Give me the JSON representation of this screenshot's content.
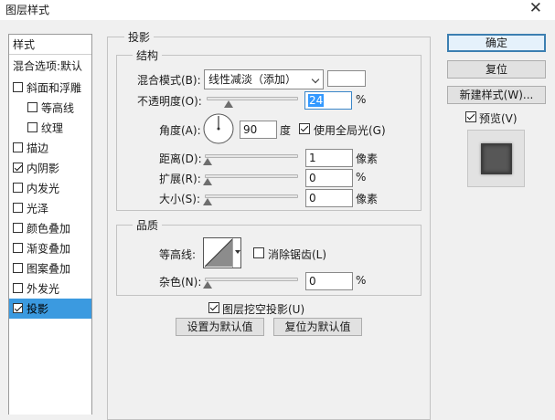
{
  "window": {
    "title": "图层样式",
    "close_glyph": "✕"
  },
  "left_panel": {
    "header": "样式",
    "blend_options": "混合选项:默认",
    "items": [
      {
        "label": "斜面和浮雕",
        "checked": false
      },
      {
        "label": "等高线",
        "checked": false
      },
      {
        "label": "纹理",
        "checked": false
      },
      {
        "label": "描边",
        "checked": false
      },
      {
        "label": "内阴影",
        "checked": true
      },
      {
        "label": "内发光",
        "checked": false
      },
      {
        "label": "光泽",
        "checked": false
      },
      {
        "label": "颜色叠加",
        "checked": false
      },
      {
        "label": "渐变叠加",
        "checked": false
      },
      {
        "label": "图案叠加",
        "checked": false
      },
      {
        "label": "外发光",
        "checked": false
      },
      {
        "label": "投影",
        "checked": true,
        "selected": true
      }
    ]
  },
  "drop_shadow": {
    "title": "投影",
    "structure": {
      "title": "结构",
      "blend_mode_label": "混合模式(B):",
      "blend_mode_value": "线性减淡（添加）",
      "blend_color": "#ffffff",
      "opacity_label": "不透明度(O):",
      "opacity_value": "24",
      "opacity_unit": "%",
      "angle_label": "角度(A):",
      "angle_value": "90",
      "angle_unit": "度",
      "global_light_label": "使用全局光(G)",
      "global_light_checked": true,
      "distance_label": "距离(D):",
      "distance_value": "1",
      "distance_unit": "像素",
      "spread_label": "扩展(R):",
      "spread_value": "0",
      "spread_unit": "%",
      "size_label": "大小(S):",
      "size_value": "0",
      "size_unit": "像素"
    },
    "quality": {
      "title": "品质",
      "contour_label": "等高线:",
      "anti_alias_label": "消除锯齿(L)",
      "anti_alias_checked": false,
      "noise_label": "杂色(N):",
      "noise_value": "0",
      "noise_unit": "%"
    },
    "knockout_label": "图层挖空投影(U)",
    "knockout_checked": true,
    "set_default_label": "设置为默认值",
    "reset_default_label": "复位为默认值"
  },
  "buttons": {
    "ok": "确定",
    "reset": "复位",
    "new_style": "新建样式(W)...",
    "preview_label": "预览(V)",
    "preview_checked": true
  }
}
